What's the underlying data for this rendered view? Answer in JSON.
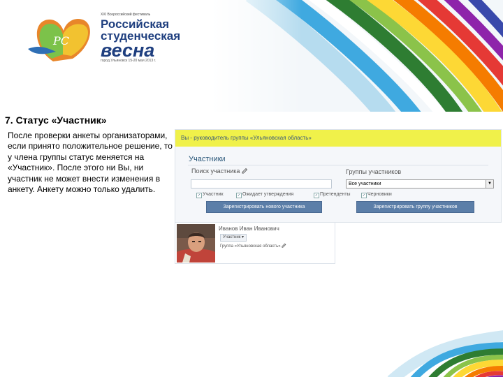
{
  "logo": {
    "top_line": "XXI Всероссийский фестиваль",
    "line1": "Российская",
    "line2": "студенческая",
    "line3": "весна",
    "bottom_line": "город Ульяновск 15-20 мая 2013 г."
  },
  "slide": {
    "title": "7. Статус «Участник»",
    "body": "После проверки анкеты организаторами, если принято положительное решение, то у члена группы статус меняется на «Участник». После этого ни Вы, ни участник не может внести изменения в анкету. Анкету можно только удалить."
  },
  "screenshot": {
    "top_bar_text": "Вы - руководитель группы «Ульяновская область»",
    "heading": "Участники",
    "search_label": "Поиск участника",
    "search_value": "",
    "group_label": "Группы участников",
    "group_selected": "Все участники",
    "filters": [
      {
        "label": "Участник",
        "checked": true
      },
      {
        "label": "Ожидает утверждения",
        "checked": true
      },
      {
        "label": "Претенденты",
        "checked": true
      },
      {
        "label": "Черновики",
        "checked": true
      }
    ],
    "register_participant_button": "Зарегистрировать нового участника",
    "register_group_button": "Зарегистрировать группу участников"
  },
  "card": {
    "name": "Иванов Иван Иванович",
    "status": "Участник",
    "group_link": "Группа «Ульяновская область»"
  },
  "colors": {
    "top_bar": "#f0f14a",
    "button": "#5b7ea8",
    "heading": "#2b587a",
    "logo_text": "#1f3f7f"
  },
  "icons": {
    "edit": "pencil-icon",
    "dropdown": "chevron-down-icon"
  }
}
